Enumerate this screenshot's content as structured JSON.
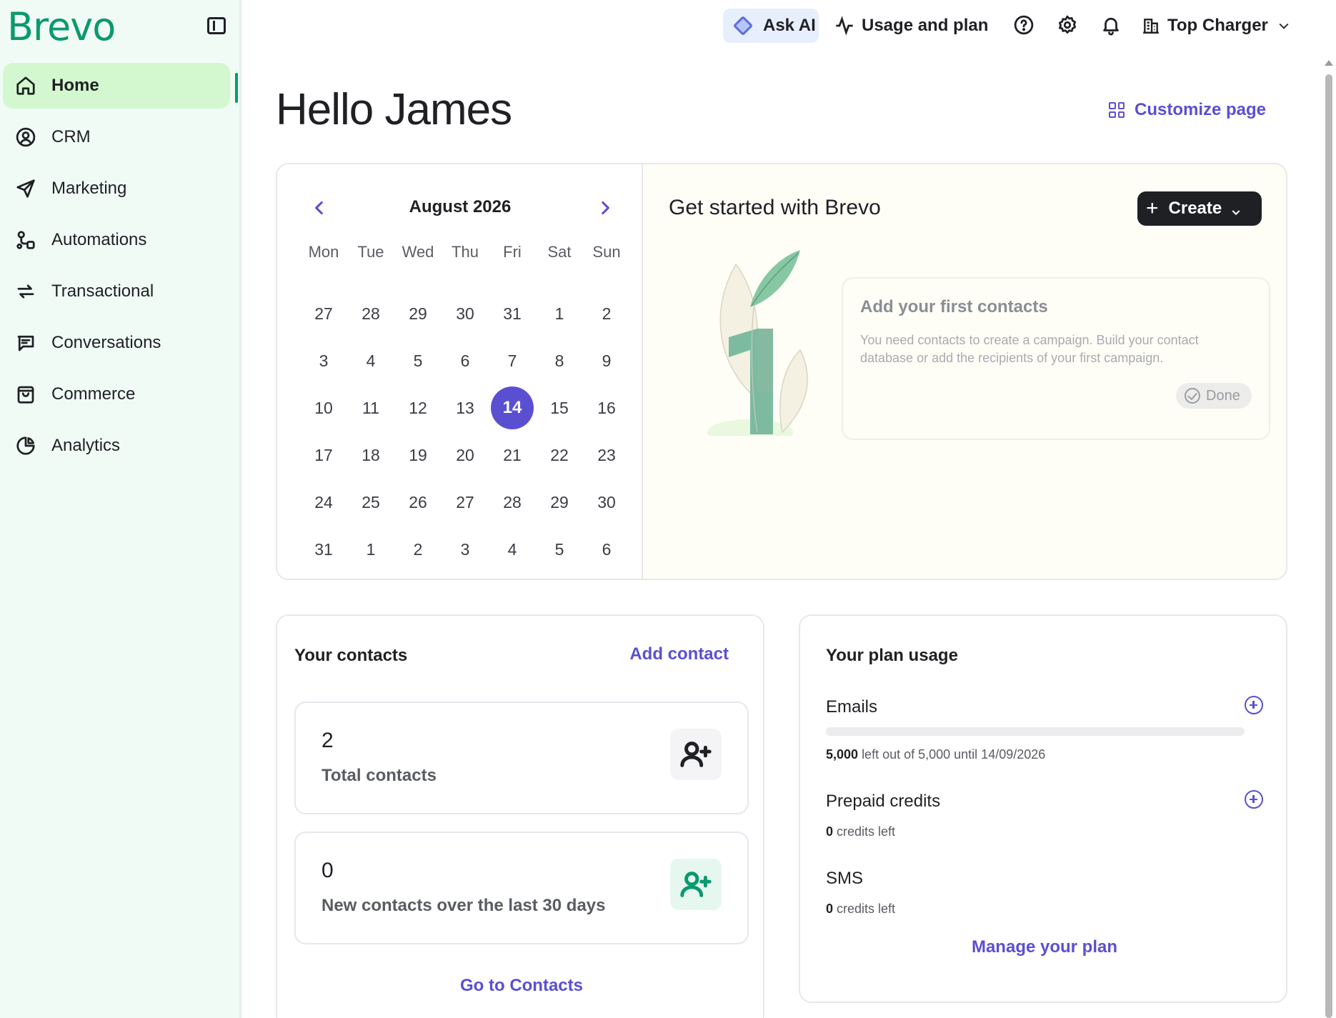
{
  "brand": {
    "logo": "Brevo",
    "accent": "#0b996e",
    "link_color": "#5b4fd1"
  },
  "sidebar": {
    "items": [
      {
        "label": "Home",
        "icon": "home-icon",
        "active": true
      },
      {
        "label": "CRM",
        "icon": "user-circle-icon"
      },
      {
        "label": "Marketing",
        "icon": "send-icon"
      },
      {
        "label": "Automations",
        "icon": "workflow-icon"
      },
      {
        "label": "Transactional",
        "icon": "arrows-exchange-icon"
      },
      {
        "label": "Conversations",
        "icon": "chat-icon"
      },
      {
        "label": "Commerce",
        "icon": "shopping-bag-icon"
      },
      {
        "label": "Analytics",
        "icon": "pie-chart-icon"
      }
    ]
  },
  "topbar": {
    "ask_ai": "Ask AI",
    "usage": "Usage and plan",
    "account": "Top Charger"
  },
  "main": {
    "greeting": "Hello James",
    "customize": "Customize page"
  },
  "calendar": {
    "title": "August 2026",
    "weekdays": [
      "Mon",
      "Tue",
      "Wed",
      "Thu",
      "Fri",
      "Sat",
      "Sun"
    ],
    "weeks": [
      [
        "27",
        "28",
        "29",
        "30",
        "31",
        "1",
        "2"
      ],
      [
        "3",
        "4",
        "5",
        "6",
        "7",
        "8",
        "9"
      ],
      [
        "10",
        "11",
        "12",
        "13",
        "14",
        "15",
        "16"
      ],
      [
        "17",
        "18",
        "19",
        "20",
        "21",
        "22",
        "23"
      ],
      [
        "24",
        "25",
        "26",
        "27",
        "28",
        "29",
        "30"
      ],
      [
        "31",
        "1",
        "2",
        "3",
        "4",
        "5",
        "6"
      ]
    ],
    "today": "14"
  },
  "get_started": {
    "title": "Get started with Brevo",
    "create_label": "Create",
    "task_title": "Add your first contacts",
    "task_desc": "You need contacts to create a campaign. Build your contact database or add the recipients of your first campaign.",
    "done_label": "Done"
  },
  "contacts": {
    "title": "Your contacts",
    "add_label": "Add contact",
    "total_value": "2",
    "total_label": "Total contacts",
    "new_value": "0",
    "new_label": "New contacts over the last 30 days",
    "go_label": "Go to Contacts"
  },
  "plan": {
    "title": "Your plan usage",
    "emails_title": "Emails",
    "emails_left": "5,000",
    "emails_detail": "left out of 5,000 until 14/09/2026",
    "emails_used_fraction": 0,
    "prepaid_title": "Prepaid credits",
    "prepaid_left": "0",
    "prepaid_detail": "credits left",
    "sms_title": "SMS",
    "sms_left": "0",
    "sms_detail": "credits left",
    "manage_label": "Manage your plan"
  }
}
